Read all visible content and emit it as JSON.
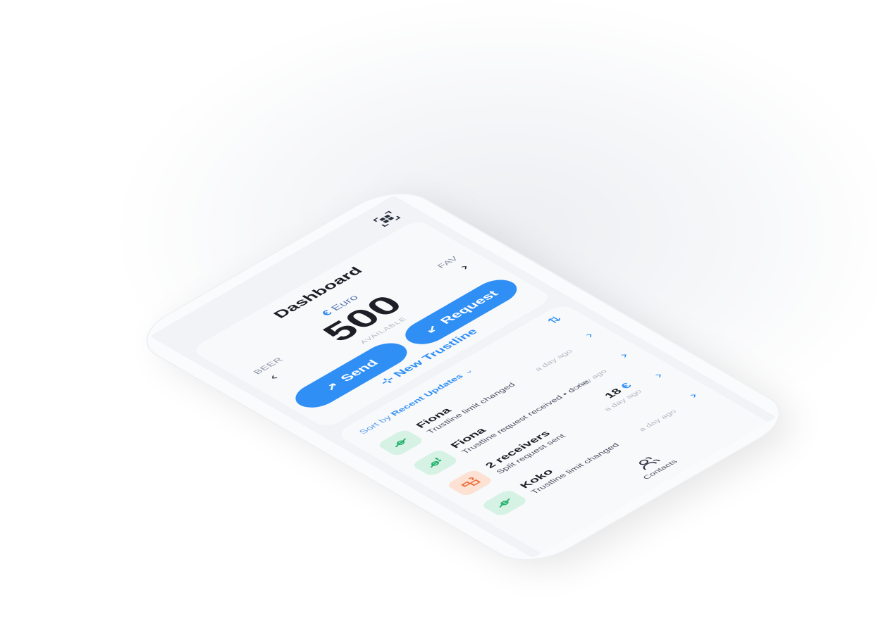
{
  "screen": {
    "title": "Dashboard"
  },
  "currency": {
    "left_label": "BEER",
    "right_label": "FAV",
    "symbol": "€",
    "name": "Euro",
    "amount": "500",
    "available_label": "AVAILABLE"
  },
  "actions": {
    "send_label": "Send",
    "request_label": "Request",
    "new_trustline_label": "New Trustline"
  },
  "list": {
    "sort_prefix": "Sort by",
    "sort_value": "Recent Updates",
    "items": [
      {
        "name": "Fiona",
        "description": "Trustline limit changed",
        "time": "a day ago",
        "icon": "trustline-icon",
        "icon_color": "green"
      },
      {
        "name": "Fiona",
        "description": "Trustline request received • done",
        "time": "a day ago",
        "icon": "trustline-request-icon",
        "icon_color": "green"
      },
      {
        "name": "2 receivers",
        "description": "Split request sent",
        "time": "a day ago",
        "amount": "18",
        "amount_currency": "€",
        "icon": "split-request-icon",
        "icon_color": "orange"
      },
      {
        "name": "Koko",
        "description": "Trustline limit changed",
        "time": "a day ago",
        "icon": "trustline-icon",
        "icon_color": "green"
      }
    ]
  },
  "nav": {
    "contacts_label": "Contacts"
  },
  "colors": {
    "accent": "#2f8ff5",
    "green_bg": "#d6f2e4",
    "orange_bg": "#fde2d4"
  }
}
